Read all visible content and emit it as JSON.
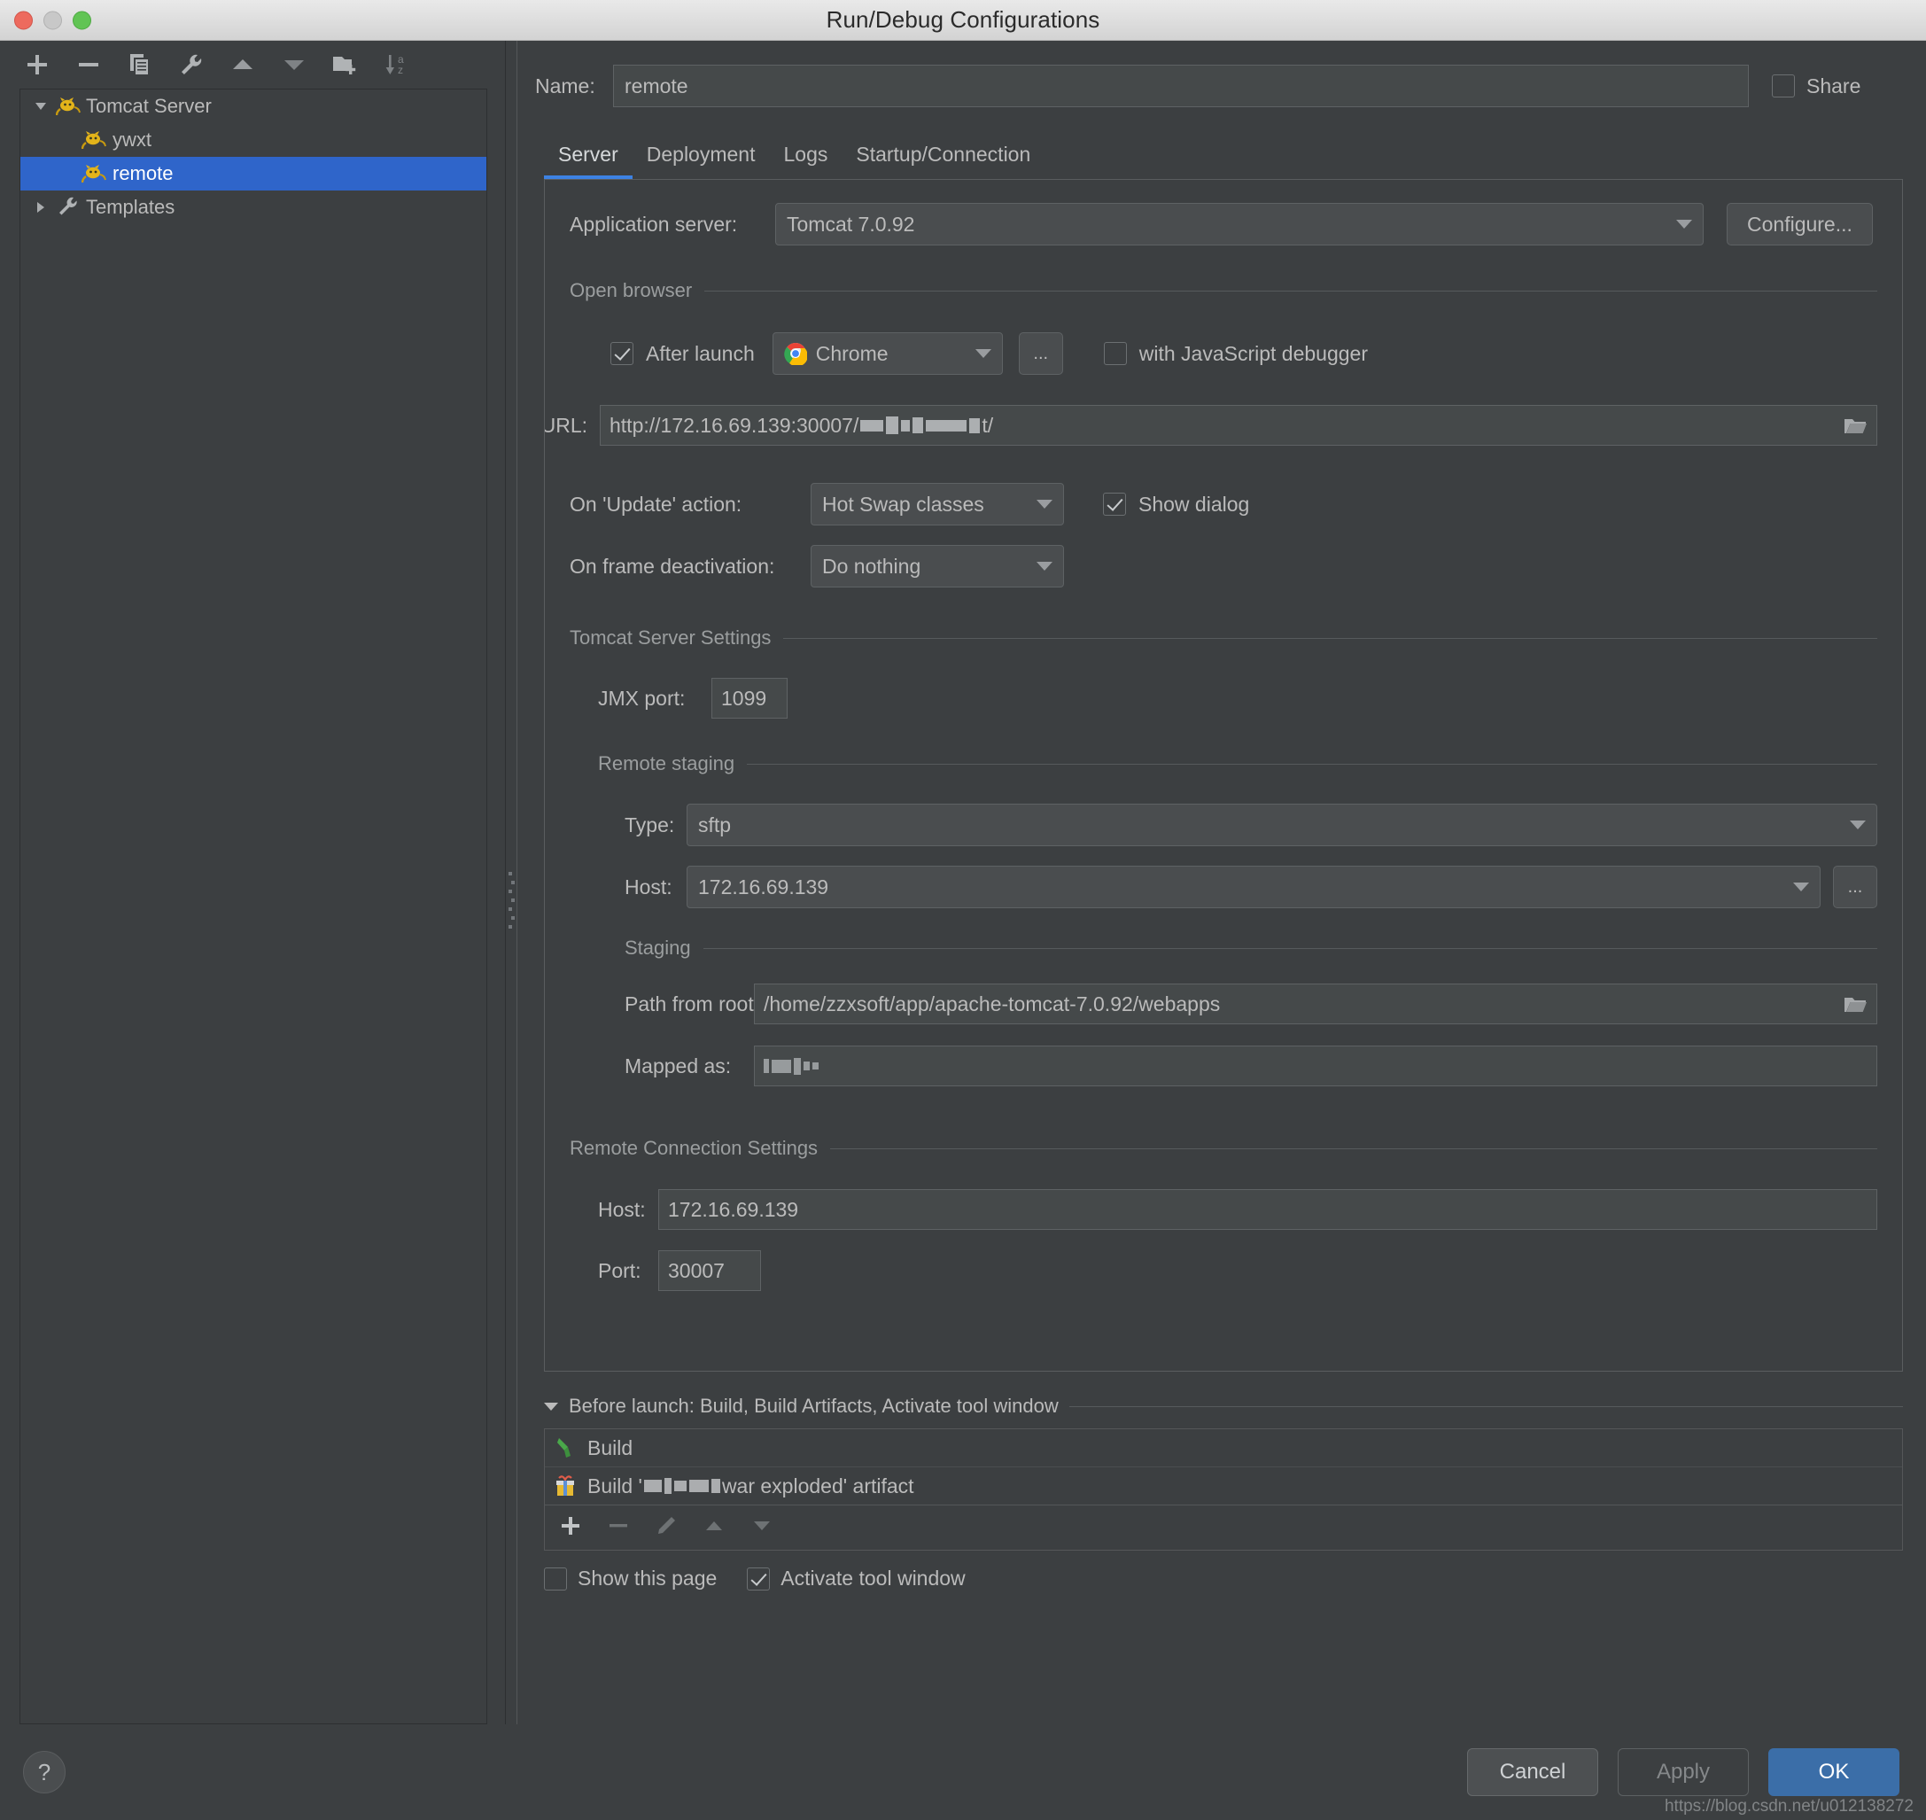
{
  "window": {
    "title": "Run/Debug Configurations"
  },
  "tree_toolbar": {
    "buttons": [
      {
        "name": "add-icon",
        "label": "+"
      },
      {
        "name": "remove-icon",
        "label": "-"
      },
      {
        "name": "copy-icon",
        "label": "Copy"
      },
      {
        "name": "edit-templates-icon",
        "label": "Edit Templates"
      },
      {
        "name": "move-up-icon",
        "label": "Move Up"
      },
      {
        "name": "move-down-icon",
        "label": "Move Down"
      },
      {
        "name": "new-folder-icon",
        "label": "New Folder"
      },
      {
        "name": "sort-alphabetically-icon",
        "label": "Sort"
      }
    ]
  },
  "tree": {
    "items": [
      {
        "label": "Tomcat Server",
        "icon": "tomcat-icon",
        "expanded": true,
        "level": 0,
        "selected": false
      },
      {
        "label": "ywxt",
        "icon": "tomcat-icon",
        "level": 1,
        "selected": false
      },
      {
        "label": "remote",
        "icon": "tomcat-icon",
        "level": 1,
        "selected": true
      },
      {
        "label": "Templates",
        "icon": "wrench-icon",
        "expanded": false,
        "level": 0,
        "selected": false
      }
    ]
  },
  "name_row": {
    "label": "Name:",
    "value": "remote",
    "placeholder": "",
    "share_label": "Share",
    "share_checked": false
  },
  "tabs": [
    {
      "label": "Server",
      "active": true
    },
    {
      "label": "Deployment",
      "active": false
    },
    {
      "label": "Logs",
      "active": false
    },
    {
      "label": "Startup/Connection",
      "active": false
    }
  ],
  "server_tab": {
    "application_server": {
      "label": "Application server:",
      "value": "Tomcat 7.0.92",
      "configure_button": "Configure..."
    },
    "open_browser": {
      "section_title": "Open browser",
      "after_launch_label": "After launch",
      "after_launch_checked": true,
      "browser_value": "Chrome",
      "browser_icon": "chrome-icon",
      "ellipsis_button": "...",
      "js_debugger_label": "with JavaScript debugger",
      "js_debugger_checked": false,
      "url_label": "URL:",
      "url_value_prefix": "http://172.16.69.139:30007/",
      "url_value_suffix": "t/",
      "url_redacted": true,
      "browse_icon": "folder-icon"
    },
    "update_action": {
      "label": "On 'Update' action:",
      "value": "Hot Swap classes",
      "show_dialog_label": "Show dialog",
      "show_dialog_checked": true
    },
    "frame_deactivation": {
      "label": "On frame deactivation:",
      "value": "Do nothing"
    },
    "tomcat_settings": {
      "section_title": "Tomcat Server Settings",
      "jmx_port_label": "JMX port:",
      "jmx_port_value": "1099"
    },
    "remote_staging": {
      "section_title": "Remote staging",
      "type_label": "Type:",
      "type_value": "sftp",
      "host_label": "Host:",
      "host_value": "172.16.69.139",
      "host_ellipsis_button": "...",
      "staging_title": "Staging",
      "path_label": "Path from root:",
      "path_value": "/home/zzxsoft/app/apache-tomcat-7.0.92/webapps",
      "path_browse_icon": "folder-icon",
      "mapped_label": "Mapped as:",
      "mapped_value": "",
      "mapped_redacted": true
    },
    "remote_connection": {
      "section_title": "Remote Connection Settings",
      "host_label": "Host:",
      "host_value": "172.16.69.139",
      "port_label": "Port:",
      "port_value": "30007"
    }
  },
  "before_launch": {
    "header": "Before launch: Build, Build Artifacts, Activate tool window",
    "items": [
      {
        "label": "Build",
        "icon": "build-hammer-icon",
        "redacted": false
      },
      {
        "label_prefix": "Build '",
        "label_suffix": "war exploded' artifact",
        "icon": "artifact-gift-icon",
        "redacted": true
      }
    ],
    "toolbar": [
      {
        "name": "add-task-icon",
        "label": "+",
        "enabled": true
      },
      {
        "name": "remove-task-icon",
        "label": "-",
        "enabled": false
      },
      {
        "name": "edit-task-icon",
        "label": "Edit",
        "enabled": false
      },
      {
        "name": "move-task-up-icon",
        "label": "Up",
        "enabled": false
      },
      {
        "name": "move-task-down-icon",
        "label": "Down",
        "enabled": false
      }
    ],
    "show_this_page_label": "Show this page",
    "show_this_page_checked": false,
    "activate_tool_window_label": "Activate tool window",
    "activate_tool_window_checked": true
  },
  "footer": {
    "help_label": "?",
    "cancel_label": "Cancel",
    "apply_label": "Apply",
    "apply_enabled": false,
    "ok_label": "OK",
    "watermark": "https://blog.csdn.net/u012138272"
  },
  "colors": {
    "background": "#3c3f41",
    "selection_blue": "#2f65ca",
    "tab_accent": "#3d82e3",
    "ok_button": "#3b6ea8",
    "text": "#bbbbbb"
  }
}
